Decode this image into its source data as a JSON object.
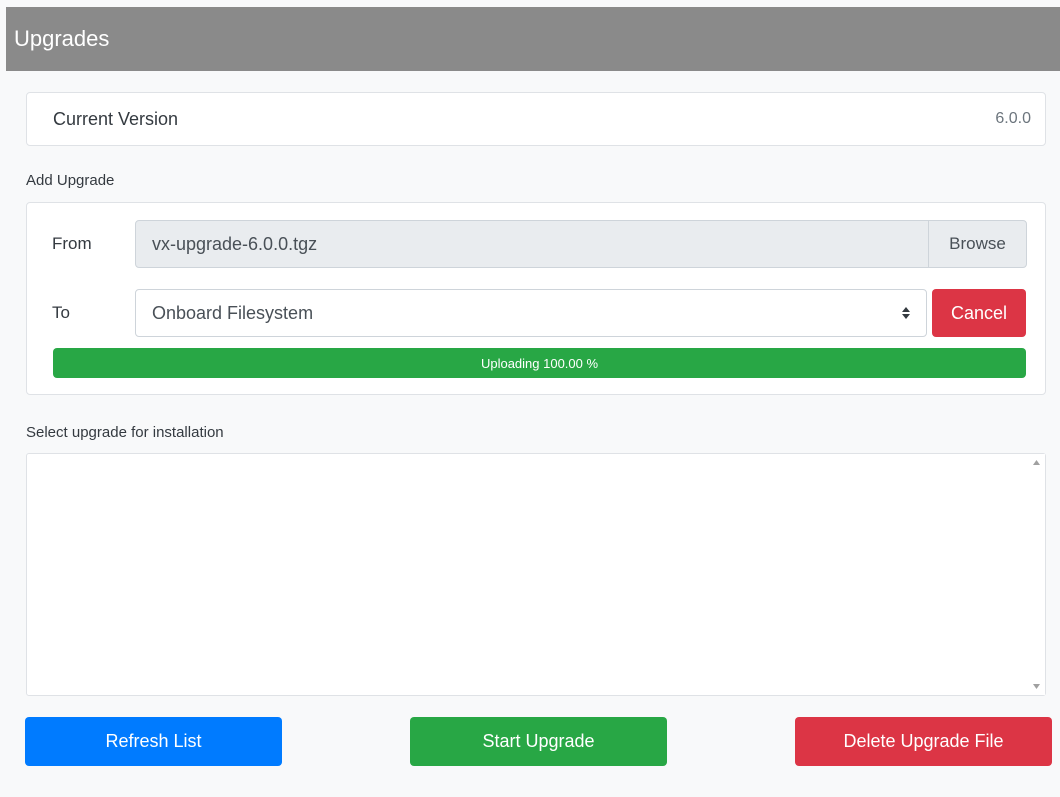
{
  "header": {
    "title": "Upgrades"
  },
  "current_version": {
    "label": "Current Version",
    "value": "6.0.0"
  },
  "add_upgrade": {
    "section_label": "Add Upgrade",
    "from_label": "From",
    "file_name": "vx-upgrade-6.0.0.tgz",
    "browse_label": "Browse",
    "to_label": "To",
    "destination_selected": "Onboard Filesystem",
    "cancel_label": "Cancel",
    "progress_text": "Uploading 100.00 %",
    "progress_value": 100
  },
  "install": {
    "section_label": "Select upgrade for installation",
    "items": []
  },
  "actions": {
    "refresh_label": "Refresh List",
    "start_label": "Start Upgrade",
    "delete_label": "Delete Upgrade File"
  },
  "colors": {
    "header_bg": "#8a8a8a",
    "primary": "#007bff",
    "success": "#28a745",
    "danger": "#dc3545"
  }
}
